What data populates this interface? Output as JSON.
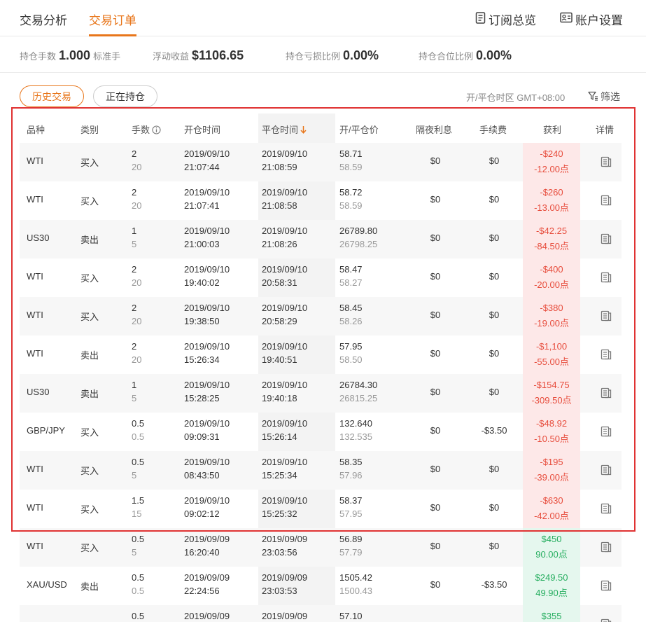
{
  "tabs": [
    {
      "label": "交易分析",
      "active": false
    },
    {
      "label": "交易订单",
      "active": true
    }
  ],
  "nav": {
    "subscribe_label": "订阅总览",
    "account_label": "账户设置"
  },
  "summary": {
    "lots_label": "持仓手数",
    "lots_value": "1.000",
    "lots_unit": "标准手",
    "float_label": "浮动收益",
    "float_value": "$1106.65",
    "pl_ratio_label": "持仓亏损比例",
    "pl_ratio_value": "0.00%",
    "position_ratio_label": "持仓合位比例",
    "position_ratio_value": "0.00%"
  },
  "buttons": {
    "history_label": "历史交易",
    "open_label": "正在持仓"
  },
  "timezone_label": "开/平仓时区 GMT+08:00",
  "filter_label": "筛选",
  "colors": {
    "accent": "#e8761b",
    "loss": "#e74c3c",
    "profit": "#27ae60",
    "highlight_box": "#e03232"
  },
  "table": {
    "headers": {
      "symbol": "品种",
      "type": "类别",
      "lots": "手数",
      "open_time": "开仓时间",
      "close_time": "平仓时间",
      "price": "开/平仓价",
      "swap": "隔夜利息",
      "fee": "手续费",
      "profit": "获利",
      "detail": "详情"
    },
    "rows": [
      {
        "symbol": "WTI",
        "type": "买入",
        "lots": "2",
        "lots_sub": "20",
        "open_date": "2019/09/10",
        "open_time": "21:07:44",
        "close_date": "2019/09/10",
        "close_time": "21:08:59",
        "open_price": "58.71",
        "close_price": "58.59",
        "swap": "$0",
        "fee": "$0",
        "profit": "-$240",
        "points": "-12.00点",
        "sign": "neg"
      },
      {
        "symbol": "WTI",
        "type": "买入",
        "lots": "2",
        "lots_sub": "20",
        "open_date": "2019/09/10",
        "open_time": "21:07:41",
        "close_date": "2019/09/10",
        "close_time": "21:08:58",
        "open_price": "58.72",
        "close_price": "58.59",
        "swap": "$0",
        "fee": "$0",
        "profit": "-$260",
        "points": "-13.00点",
        "sign": "neg"
      },
      {
        "symbol": "US30",
        "type": "卖出",
        "lots": "1",
        "lots_sub": "5",
        "open_date": "2019/09/10",
        "open_time": "21:00:03",
        "close_date": "2019/09/10",
        "close_time": "21:08:26",
        "open_price": "26789.80",
        "close_price": "26798.25",
        "swap": "$0",
        "fee": "$0",
        "profit": "-$42.25",
        "points": "-84.50点",
        "sign": "neg"
      },
      {
        "symbol": "WTI",
        "type": "买入",
        "lots": "2",
        "lots_sub": "20",
        "open_date": "2019/09/10",
        "open_time": "19:40:02",
        "close_date": "2019/09/10",
        "close_time": "20:58:31",
        "open_price": "58.47",
        "close_price": "58.27",
        "swap": "$0",
        "fee": "$0",
        "profit": "-$400",
        "points": "-20.00点",
        "sign": "neg"
      },
      {
        "symbol": "WTI",
        "type": "买入",
        "lots": "2",
        "lots_sub": "20",
        "open_date": "2019/09/10",
        "open_time": "19:38:50",
        "close_date": "2019/09/10",
        "close_time": "20:58:29",
        "open_price": "58.45",
        "close_price": "58.26",
        "swap": "$0",
        "fee": "$0",
        "profit": "-$380",
        "points": "-19.00点",
        "sign": "neg"
      },
      {
        "symbol": "WTI",
        "type": "卖出",
        "lots": "2",
        "lots_sub": "20",
        "open_date": "2019/09/10",
        "open_time": "15:26:34",
        "close_date": "2019/09/10",
        "close_time": "19:40:51",
        "open_price": "57.95",
        "close_price": "58.50",
        "swap": "$0",
        "fee": "$0",
        "profit": "-$1,100",
        "points": "-55.00点",
        "sign": "neg"
      },
      {
        "symbol": "US30",
        "type": "卖出",
        "lots": "1",
        "lots_sub": "5",
        "open_date": "2019/09/10",
        "open_time": "15:28:25",
        "close_date": "2019/09/10",
        "close_time": "19:40:18",
        "open_price": "26784.30",
        "close_price": "26815.25",
        "swap": "$0",
        "fee": "$0",
        "profit": "-$154.75",
        "points": "-309.50点",
        "sign": "neg"
      },
      {
        "symbol": "GBP/JPY",
        "type": "买入",
        "lots": "0.5",
        "lots_sub": "0.5",
        "open_date": "2019/09/10",
        "open_time": "09:09:31",
        "close_date": "2019/09/10",
        "close_time": "15:26:14",
        "open_price": "132.640",
        "close_price": "132.535",
        "swap": "$0",
        "fee": "-$3.50",
        "profit": "-$48.92",
        "points": "-10.50点",
        "sign": "neg"
      },
      {
        "symbol": "WTI",
        "type": "买入",
        "lots": "0.5",
        "lots_sub": "5",
        "open_date": "2019/09/10",
        "open_time": "08:43:50",
        "close_date": "2019/09/10",
        "close_time": "15:25:34",
        "open_price": "58.35",
        "close_price": "57.96",
        "swap": "$0",
        "fee": "$0",
        "profit": "-$195",
        "points": "-39.00点",
        "sign": "neg"
      },
      {
        "symbol": "WTI",
        "type": "买入",
        "lots": "1.5",
        "lots_sub": "15",
        "open_date": "2019/09/10",
        "open_time": "09:02:12",
        "close_date": "2019/09/10",
        "close_time": "15:25:32",
        "open_price": "58.37",
        "close_price": "57.95",
        "swap": "$0",
        "fee": "$0",
        "profit": "-$630",
        "points": "-42.00点",
        "sign": "neg"
      },
      {
        "symbol": "WTI",
        "type": "买入",
        "lots": "0.5",
        "lots_sub": "5",
        "open_date": "2019/09/09",
        "open_time": "16:20:40",
        "close_date": "2019/09/09",
        "close_time": "23:03:56",
        "open_price": "56.89",
        "close_price": "57.79",
        "swap": "$0",
        "fee": "$0",
        "profit": "$450",
        "points": "90.00点",
        "sign": "pos"
      },
      {
        "symbol": "XAU/USD",
        "type": "卖出",
        "lots": "0.5",
        "lots_sub": "0.5",
        "open_date": "2019/09/09",
        "open_time": "22:24:56",
        "close_date": "2019/09/09",
        "close_time": "23:03:53",
        "open_price": "1505.42",
        "close_price": "1500.43",
        "swap": "$0",
        "fee": "-$3.50",
        "profit": "$249.50",
        "points": "49.90点",
        "sign": "pos"
      },
      {
        "symbol": "",
        "type": "",
        "lots": "0.5",
        "lots_sub": "",
        "open_date": "2019/09/09",
        "open_time": "",
        "close_date": "2019/09/09",
        "close_time": "",
        "open_price": "57.10",
        "close_price": "",
        "swap": "",
        "fee": "",
        "profit": "$355",
        "points": "",
        "sign": "pos"
      }
    ]
  }
}
